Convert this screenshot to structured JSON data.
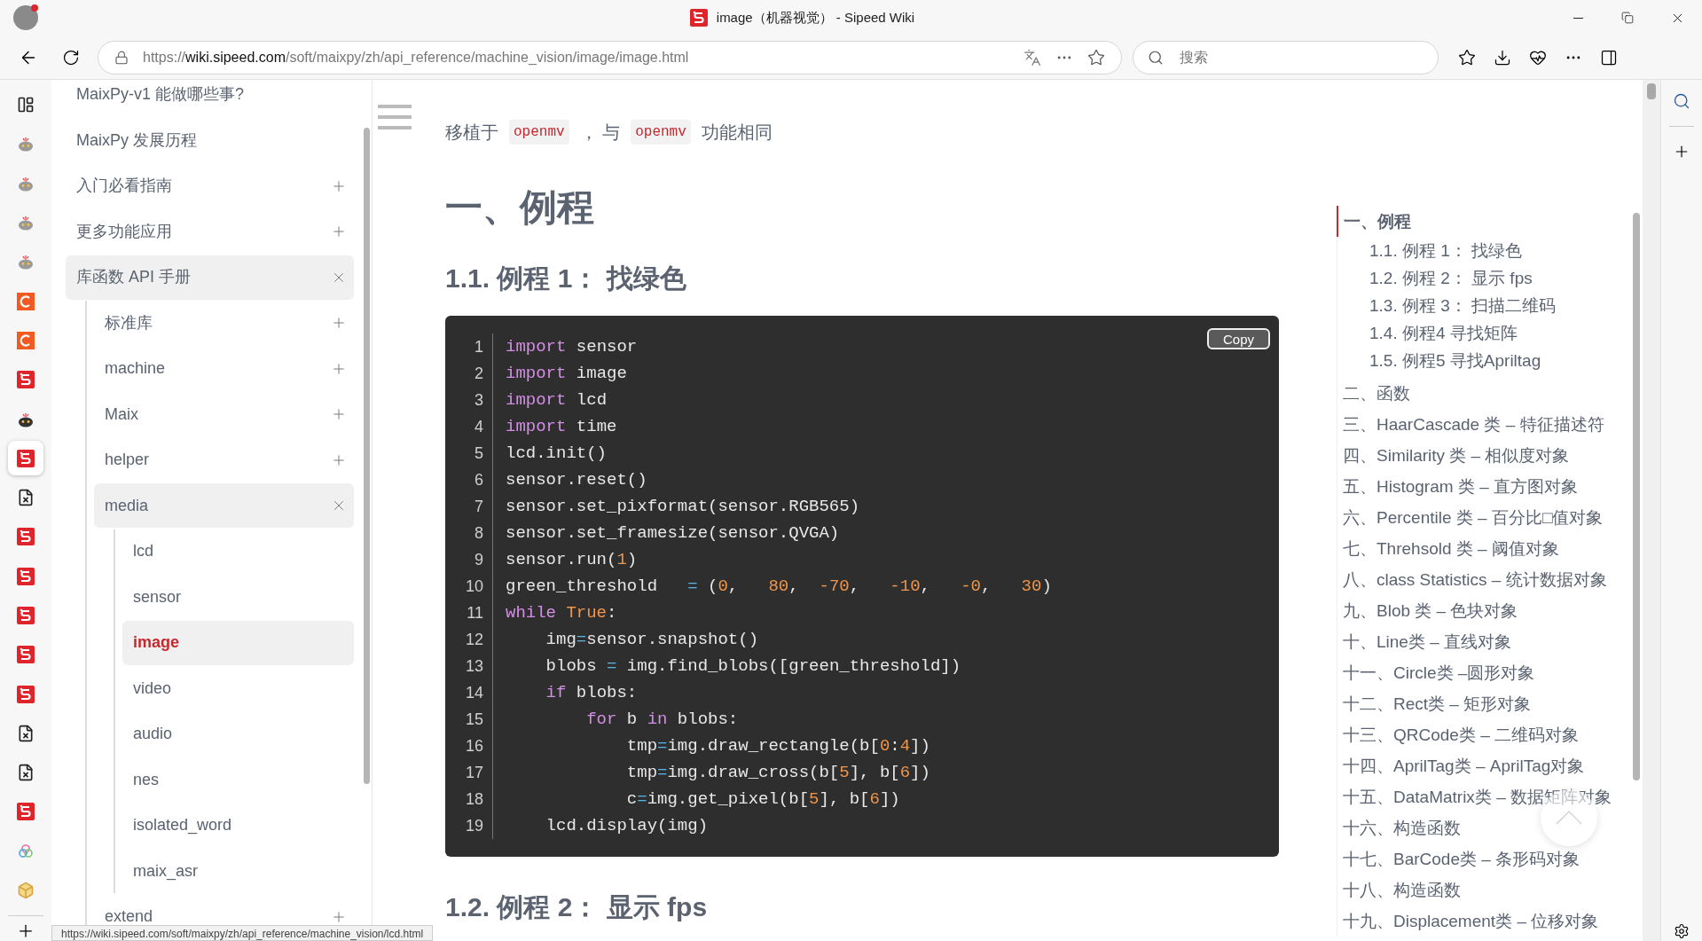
{
  "window": {
    "title": "image（机器视觉） - Sipeed Wiki"
  },
  "address_bar": {
    "scheme": "https://",
    "host": "wiki.sipeed.com",
    "path": "/soft/maixpy/zh/api_reference/machine_vision/image/image.html"
  },
  "search": {
    "placeholder": "搜索"
  },
  "vertical_tabs": [
    {
      "kind": "layout",
      "selected": false
    },
    {
      "kind": "bot",
      "selected": false
    },
    {
      "kind": "bot",
      "selected": false
    },
    {
      "kind": "bot",
      "selected": false
    },
    {
      "kind": "bot",
      "selected": false
    },
    {
      "kind": "c",
      "selected": false
    },
    {
      "kind": "c",
      "selected": false
    },
    {
      "kind": "s",
      "selected": false
    },
    {
      "kind": "darkbot",
      "selected": false
    },
    {
      "kind": "s",
      "selected": true
    },
    {
      "kind": "doc",
      "selected": false
    },
    {
      "kind": "s",
      "selected": false
    },
    {
      "kind": "s",
      "selected": false
    },
    {
      "kind": "s",
      "selected": false
    },
    {
      "kind": "s",
      "selected": false
    },
    {
      "kind": "s",
      "selected": false
    },
    {
      "kind": "doc",
      "selected": false
    },
    {
      "kind": "doc",
      "selected": false
    },
    {
      "kind": "s",
      "selected": false
    },
    {
      "kind": "rings",
      "selected": false
    },
    {
      "kind": "cube",
      "selected": false
    }
  ],
  "sidebar": {
    "items": [
      {
        "label": "MaixPy-v1 能做哪些事?",
        "selected": false
      },
      {
        "label": "MaixPy 发展历程",
        "selected": false
      },
      {
        "label": "入门必看指南",
        "expanded": false,
        "selected": false
      },
      {
        "label": "更多功能应用",
        "expanded": false,
        "selected": false
      },
      {
        "label": "库函数 API 手册",
        "expanded": true,
        "selected": false,
        "children": [
          {
            "label": "标准库",
            "expanded": false,
            "selected": false
          },
          {
            "label": "machine",
            "expanded": false,
            "selected": false
          },
          {
            "label": "Maix",
            "expanded": false,
            "selected": false
          },
          {
            "label": "helper",
            "expanded": false,
            "selected": false
          },
          {
            "label": "media",
            "expanded": true,
            "selected": false,
            "children": [
              {
                "label": "lcd",
                "selected": false
              },
              {
                "label": "sensor",
                "selected": false
              },
              {
                "label": "image",
                "selected": true
              },
              {
                "label": "video",
                "selected": false
              },
              {
                "label": "audio",
                "selected": false
              },
              {
                "label": "nes",
                "selected": false
              },
              {
                "label": "isolated_word",
                "selected": false
              },
              {
                "label": "maix_asr",
                "selected": false
              }
            ]
          },
          {
            "label": "extend",
            "expanded": false,
            "selected": false
          }
        ]
      }
    ]
  },
  "status_url": "https://wiki.sipeed.com/soft/maixpy/zh/api_reference/machine_vision/lcd.html",
  "content": {
    "intro": [
      {
        "kind": "text",
        "t": "移植于"
      },
      {
        "kind": "code",
        "t": "openmv"
      },
      {
        "kind": "text",
        "t": "， 与"
      },
      {
        "kind": "code",
        "t": "openmv"
      },
      {
        "kind": "text",
        "t": "功能相同"
      }
    ],
    "h1": "一、例程",
    "h2": "1.1. 例程 1： 找绿色",
    "copy_button": "Copy",
    "code": [
      [
        {
          "kind": "keyword",
          "t": "import"
        },
        {
          "kind": "plain",
          "t": " sensor"
        }
      ],
      [
        {
          "kind": "keyword",
          "t": "import"
        },
        {
          "kind": "plain",
          "t": " image"
        }
      ],
      [
        {
          "kind": "keyword",
          "t": "import"
        },
        {
          "kind": "plain",
          "t": " lcd"
        }
      ],
      [
        {
          "kind": "keyword",
          "t": "import"
        },
        {
          "kind": "plain",
          "t": " time"
        }
      ],
      [
        {
          "kind": "plain",
          "t": "lcd.init()"
        }
      ],
      [
        {
          "kind": "plain",
          "t": "sensor.reset()"
        }
      ],
      [
        {
          "kind": "plain",
          "t": "sensor.set_pixformat(sensor.RGB565)"
        }
      ],
      [
        {
          "kind": "plain",
          "t": "sensor.set_framesize(sensor.QVGA)"
        }
      ],
      [
        {
          "kind": "plain",
          "t": "sensor.run("
        },
        {
          "kind": "number",
          "t": "1"
        },
        {
          "kind": "plain",
          "t": ")"
        }
      ],
      [
        {
          "kind": "plain",
          "t": "green_threshold   "
        },
        {
          "kind": "operator",
          "t": "="
        },
        {
          "kind": "plain",
          "t": " ("
        },
        {
          "kind": "number",
          "t": "0"
        },
        {
          "kind": "plain",
          "t": ",   "
        },
        {
          "kind": "number",
          "t": "80"
        },
        {
          "kind": "plain",
          "t": ",  "
        },
        {
          "kind": "number",
          "t": "-70"
        },
        {
          "kind": "plain",
          "t": ",   "
        },
        {
          "kind": "number",
          "t": "-10"
        },
        {
          "kind": "plain",
          "t": ",   "
        },
        {
          "kind": "number",
          "t": "-0"
        },
        {
          "kind": "plain",
          "t": ",   "
        },
        {
          "kind": "number",
          "t": "30"
        },
        {
          "kind": "plain",
          "t": ")"
        }
      ],
      [
        {
          "kind": "keyword",
          "t": "while"
        },
        {
          "kind": "number",
          "t": " True"
        },
        {
          "kind": "plain",
          "t": ":"
        }
      ],
      [
        {
          "kind": "plain",
          "t": "    img"
        },
        {
          "kind": "operator",
          "t": "="
        },
        {
          "kind": "plain",
          "t": "sensor.snapshot()"
        }
      ],
      [
        {
          "kind": "plain",
          "t": "    blobs "
        },
        {
          "kind": "operator",
          "t": "="
        },
        {
          "kind": "plain",
          "t": " img.find_blobs([green_threshold])"
        }
      ],
      [
        {
          "kind": "keyword",
          "t": "    if"
        },
        {
          "kind": "plain",
          "t": " blobs:"
        }
      ],
      [
        {
          "kind": "keyword",
          "t": "        for"
        },
        {
          "kind": "plain",
          "t": " b "
        },
        {
          "kind": "keyword",
          "t": "in"
        },
        {
          "kind": "plain",
          "t": " blobs:"
        }
      ],
      [
        {
          "kind": "plain",
          "t": "            tmp"
        },
        {
          "kind": "operator",
          "t": "="
        },
        {
          "kind": "plain",
          "t": "img.draw_rectangle(b["
        },
        {
          "kind": "number",
          "t": "0"
        },
        {
          "kind": "plain",
          "t": ":"
        },
        {
          "kind": "number",
          "t": "4"
        },
        {
          "kind": "plain",
          "t": "])"
        }
      ],
      [
        {
          "kind": "plain",
          "t": "            tmp"
        },
        {
          "kind": "operator",
          "t": "="
        },
        {
          "kind": "plain",
          "t": "img.draw_cross(b["
        },
        {
          "kind": "number",
          "t": "5"
        },
        {
          "kind": "plain",
          "t": "], b["
        },
        {
          "kind": "number",
          "t": "6"
        },
        {
          "kind": "plain",
          "t": "])"
        }
      ],
      [
        {
          "kind": "plain",
          "t": "            c"
        },
        {
          "kind": "operator",
          "t": "="
        },
        {
          "kind": "plain",
          "t": "img.get_pixel(b["
        },
        {
          "kind": "number",
          "t": "5"
        },
        {
          "kind": "plain",
          "t": "], b["
        },
        {
          "kind": "number",
          "t": "6"
        },
        {
          "kind": "plain",
          "t": "])"
        }
      ],
      [
        {
          "kind": "plain",
          "t": "    lcd.display(img)"
        }
      ]
    ],
    "line_numbers": [
      "1",
      "2",
      "3",
      "4",
      "5",
      "6",
      "7",
      "8",
      "9",
      "10",
      "11",
      "12",
      "13",
      "14",
      "15",
      "16",
      "17",
      "18",
      "19"
    ],
    "h2_next": "1.2. 例程 2： 显示 fps"
  },
  "toc": [
    {
      "label": "一、例程",
      "selected": true,
      "children": [
        {
          "label": "1.1. 例程 1： 找绿色",
          "selected": false
        },
        {
          "label": "1.2. 例程 2： 显示 fps",
          "selected": false
        },
        {
          "label": "1.3. 例程 3： 扫描二维码",
          "selected": false
        },
        {
          "label": "1.4. 例程4 寻找矩阵",
          "selected": false
        },
        {
          "label": "1.5. 例程5 寻找Apriltag",
          "selected": false
        }
      ]
    },
    {
      "label": "二、函数",
      "selected": false
    },
    {
      "label": "三、HaarCascade 类 – 特征描述符",
      "selected": false
    },
    {
      "label": "四、Similarity 类 – 相似度对象",
      "selected": false
    },
    {
      "label": "五、Histogram 类 – 直方图对象",
      "selected": false
    },
    {
      "label": "六、Percentile 类 – 百分比□值对象",
      "selected": false
    },
    {
      "label": "七、Threhsold 类 – 阈值对象",
      "selected": false
    },
    {
      "label": "八、class Statistics – 统计数据对象",
      "selected": false
    },
    {
      "label": "九、Blob 类 – 色块对象",
      "selected": false
    },
    {
      "label": "十、Line类 – 直线对象",
      "selected": false
    },
    {
      "label": "十一、Circle类 –圆形对象",
      "selected": false
    },
    {
      "label": "十二、Rect类 – 矩形对象",
      "selected": false
    },
    {
      "label": "十三、QRCode类 – 二维码对象",
      "selected": false
    },
    {
      "label": "十四、AprilTag类 – AprilTag对象",
      "selected": false
    },
    {
      "label": "十五、DataMatrix类 – 数据矩阵对象",
      "selected": false
    },
    {
      "label": "十六、构造函数",
      "selected": false
    },
    {
      "label": "十七、BarCode类 – 条形码对象",
      "selected": false
    },
    {
      "label": "十八、构造函数",
      "selected": false
    },
    {
      "label": "十九、Displacement类 – 位移对象",
      "selected": false
    }
  ]
}
